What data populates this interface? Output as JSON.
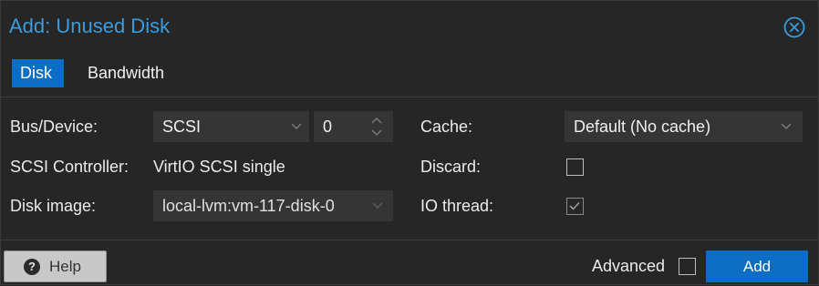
{
  "dialog": {
    "title": "Add: Unused Disk",
    "close_icon": "close-circle-icon"
  },
  "tabs": [
    {
      "label": "Disk",
      "active": true
    },
    {
      "label": "Bandwidth",
      "active": false
    }
  ],
  "form": {
    "bus_device": {
      "label": "Bus/Device:",
      "bus": "SCSI",
      "device": "0"
    },
    "scsi_controller": {
      "label": "SCSI Controller:",
      "value": "VirtIO SCSI single"
    },
    "disk_image": {
      "label": "Disk image:",
      "value": "local-lvm:vm-117-disk-0"
    },
    "cache": {
      "label": "Cache:",
      "value": "Default (No cache)"
    },
    "discard": {
      "label": "Discard:",
      "checked": false
    },
    "io_thread": {
      "label": "IO thread:",
      "checked": true
    }
  },
  "footer": {
    "help_label": "Help",
    "advanced_label": "Advanced",
    "advanced_checked": false,
    "add_label": "Add"
  },
  "colors": {
    "accent": "#0b6ec4",
    "title": "#3a9ce0",
    "background": "#262626"
  }
}
